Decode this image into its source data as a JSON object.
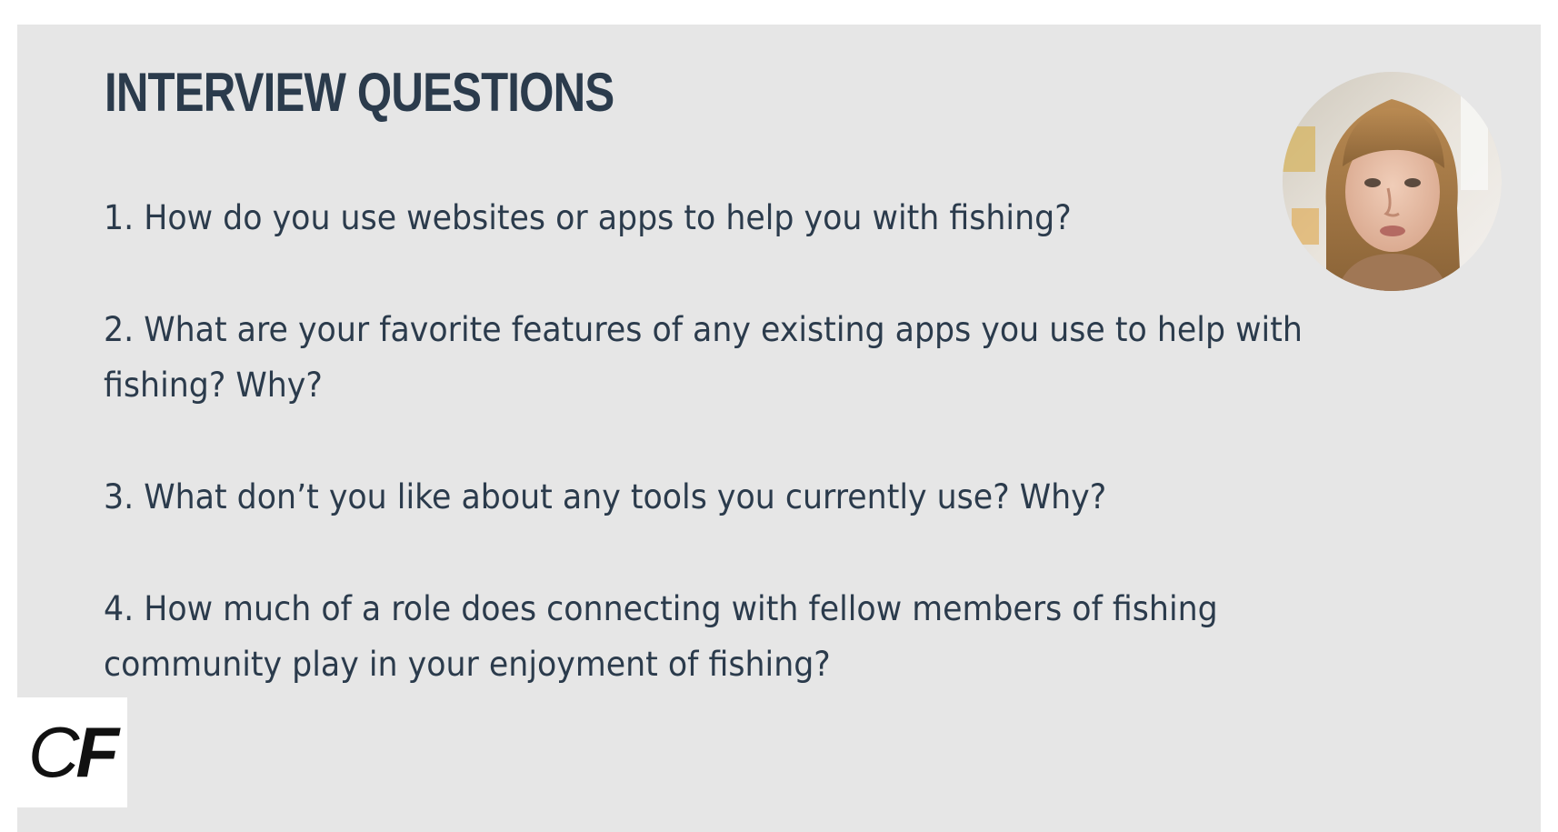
{
  "slide": {
    "title": "INTERVIEW QUESTIONS",
    "questions": [
      "1. How do you use websites or apps to help you with fishing?",
      "2. What are your favorite features of any existing apps you use to help with fishing? Why?",
      "3. What don’t you like about any tools you currently use? Why?",
      "4. How much of a role does connecting with fellow members of fishing community play in your enjoyment of fishing?"
    ]
  },
  "logo": {
    "letter_1": "C",
    "letter_2": "F"
  },
  "colors": {
    "slide_background": "#e6e6e6",
    "text": "#2b3b4c",
    "logo_background": "#ffffff",
    "logo_text": "#111111"
  }
}
